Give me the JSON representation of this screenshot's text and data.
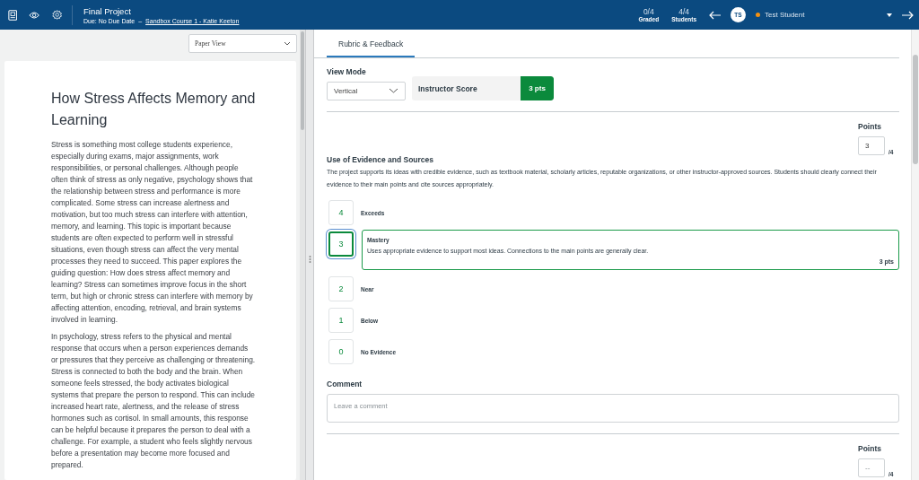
{
  "header": {
    "title": "Final Project",
    "due": "Due: No Due Date",
    "separator": "–",
    "course_link": "Sandbox Course 1 - Katie Keeton",
    "graded_count": "0/4",
    "graded_label": "Graded",
    "students_count": "4/4",
    "students_label": "Students",
    "avatar_initials": "TS",
    "student": {
      "name": "Test Student",
      "color": "#f5900f"
    }
  },
  "left": {
    "view_select": "Paper View",
    "paper": {
      "title": "How Stress Affects Memory and Learning",
      "paragraphs": [
        "Stress is something most college students experience, especially during exams, major assignments, work responsibilities, or personal challenges. Although people often think of stress as only negative, psychology shows that the relationship between stress and performance is more complicated. Some stress can increase alertness and motivation, but too much stress can interfere with attention, memory, and learning. This topic is important because students are often expected to perform well in stressful situations, even though stress can affect the very mental processes they need to succeed. This paper explores the guiding question: How does stress affect memory and learning? Stress can sometimes improve focus in the short term, but high or chronic stress can interfere with memory by affecting attention, encoding, retrieval, and brain systems involved in learning.",
        "In psychology, stress refers to the physical and mental response that occurs when a person experiences demands or pressures that they perceive as challenging or threatening. Stress is connected to both the body and the brain. When someone feels stressed, the body activates biological systems that prepare the person to respond. This can include increased heart rate, alertness, and the release of stress hormones such as cortisol. In small amounts, this response can be helpful because it prepares the person to deal with a challenge. For example, a student who feels slightly nervous before a presentation may become more focused and prepared."
      ]
    }
  },
  "right": {
    "tabs": [
      {
        "label": "Rubric & Feedback",
        "selected": true
      }
    ],
    "view_mode_label": "View Mode",
    "view_mode_value": "Vertical",
    "instructor_score_label": "Instructor Score",
    "instructor_score": "3 pts",
    "criteria": [
      {
        "points_label": "Points",
        "points_value": "3",
        "points_max": "/4",
        "title": "Use of Evidence and Sources",
        "description": "The project supports its ideas with credible evidence, such as textbook material, scholarly articles, reputable organizations, or other instructor-approved sources. Students should clearly connect their evidence to their main points and cite sources appropriately.",
        "ratings": [
          {
            "score": "4",
            "label": "Exceeds",
            "selected": false
          },
          {
            "score": "3",
            "label": "Mastery",
            "selected": true,
            "description": "Uses appropriate evidence to support most ideas. Connections to the main points are generally clear.",
            "pts": "3 pts"
          },
          {
            "score": "2",
            "label": "Near",
            "selected": false
          },
          {
            "score": "1",
            "label": "Below",
            "selected": false
          },
          {
            "score": "0",
            "label": "No Evidence",
            "selected": false
          }
        ],
        "comment_label": "Comment",
        "comment_placeholder": "Leave a comment"
      },
      {
        "points_label": "Points",
        "points_placeholder": "--",
        "points_max": "/4"
      }
    ]
  }
}
